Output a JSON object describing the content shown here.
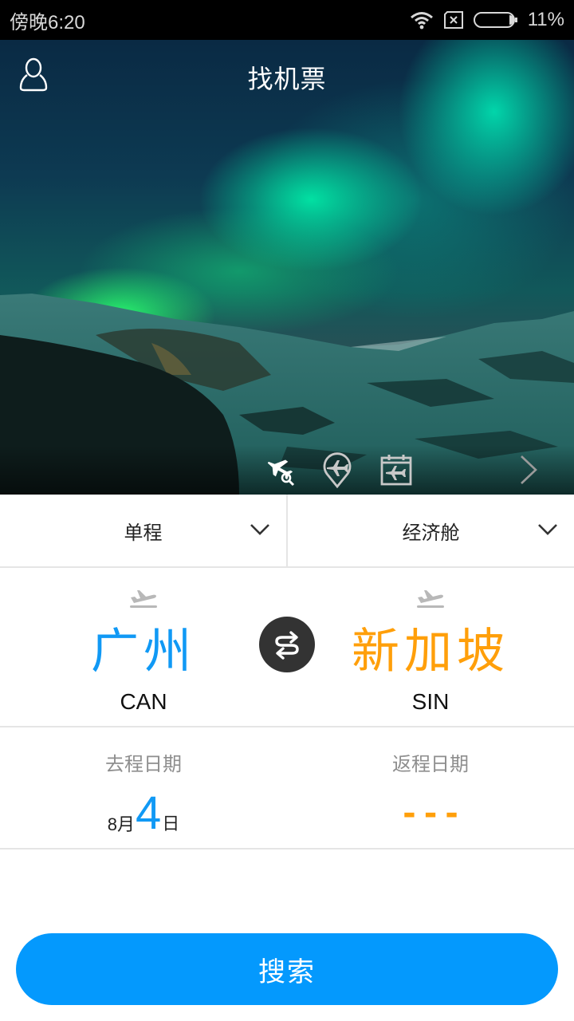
{
  "status_bar": {
    "time": "傍晚6:20",
    "battery_percent": "11%",
    "icons": [
      "wifi-icon",
      "no-sim-icon",
      "battery-icon"
    ]
  },
  "header": {
    "title": "找机票",
    "user_icon": "user-icon"
  },
  "hero_tabs": [
    {
      "name": "flight-search-icon",
      "active": true
    },
    {
      "name": "flight-location-icon",
      "active": false
    },
    {
      "name": "flight-calendar-icon",
      "active": false
    },
    {
      "name": "chevron-right-icon",
      "active": false
    }
  ],
  "selectors": {
    "trip_type": "单程",
    "cabin_class": "经济舱"
  },
  "route": {
    "from": {
      "city": "广州",
      "code": "CAN"
    },
    "to": {
      "city": "新加坡",
      "code": "SIN"
    },
    "swap_icon": "swap-icon"
  },
  "dates": {
    "departure_label": "去程日期",
    "departure_month": "8月",
    "departure_day": "4",
    "departure_day_suffix": "日",
    "return_label": "返程日期",
    "return_value": "---"
  },
  "search_button": "搜索",
  "colors": {
    "accent_blue": "#0499fd",
    "from_city": "#1099f5",
    "to_city": "#ff9f0a",
    "swap_bg": "#333333"
  }
}
